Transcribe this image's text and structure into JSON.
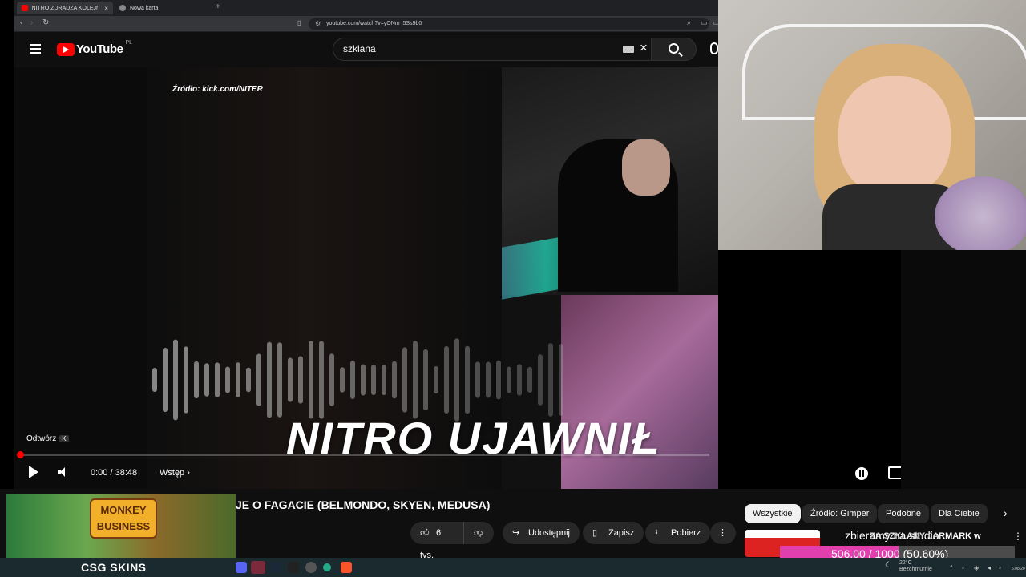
{
  "browser": {
    "tabs": [
      {
        "title": "NITRO ZDRADZA KOLEJNE INFO",
        "active": true,
        "favicon_color": "#ff0000"
      },
      {
        "title": "Nowa karta",
        "active": false,
        "favicon_color": "#888888"
      }
    ],
    "tab_close": "×",
    "new_tab": "+",
    "url": "youtube.com/watch?v=yONm_5Ss9b0"
  },
  "youtube": {
    "logo_word": "YouTube",
    "country": "PL",
    "search_value": "szklana",
    "clear_icon": "×"
  },
  "video": {
    "source_caption": "Źródło: kick.com/NITER",
    "overlay_text": "NITRO UJAWNIŁ",
    "tooltip_label": "Odtwórz",
    "tooltip_key": "K",
    "time": "0:00 / 38:48",
    "chapter": "Wstęp",
    "progress": 0.0
  },
  "below": {
    "title": "JE O FAGACIE (BELMONDO, SKYEN, MEDUSA)",
    "ad_text": "MONKEY BUSINESS",
    "actions": {
      "likes": "6 tys.",
      "share": "Udostępnij",
      "save": "Zapisz",
      "download": "Pobierz",
      "more": "⋮"
    },
    "chips": [
      "Wszystkie",
      "Źródło: Gimper",
      "Podobne",
      "Dla Ciebie"
    ],
    "chip_next": "›",
    "reco_title": "ZA SZKLANY JARMARK w"
  },
  "overlay_goal": {
    "label": "zbieramy na studio",
    "text": "506.00 / 1000 (50.60%)",
    "fraction": 0.506,
    "color": "#e23fae"
  },
  "taskbar": {
    "brand": "CSG SKINS",
    "weather_temp": "22°C",
    "weather_desc": "Bezchmurnie",
    "date": "5.08.20"
  }
}
